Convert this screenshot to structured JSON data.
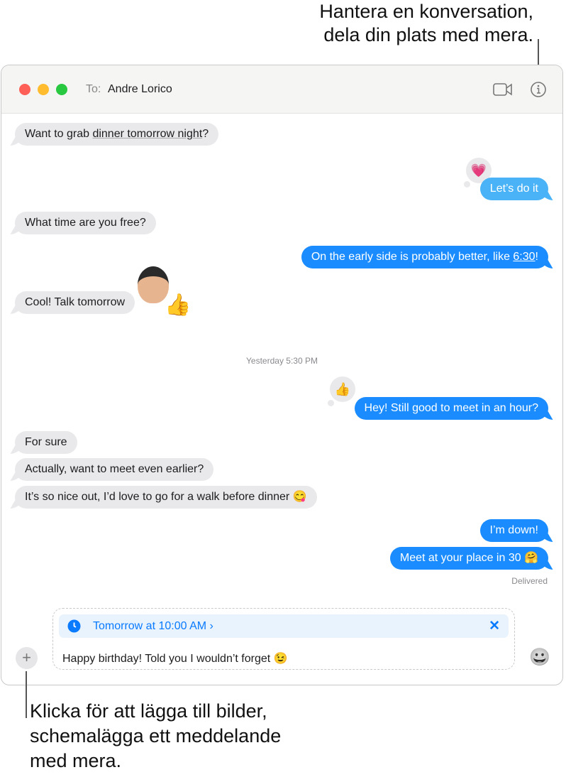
{
  "callouts": {
    "top": [
      "Hantera en konversation,",
      "dela din plats med mera."
    ],
    "bottom": [
      "Klicka för att lägga till bilder,",
      "schemalägga ett meddelande",
      "med mera."
    ]
  },
  "header": {
    "to_label": "To:",
    "recipient": "Andre Lorico",
    "icons": [
      "video-camera-icon",
      "info-icon"
    ]
  },
  "colors": {
    "sent": "#1a8cff",
    "sent_light": "#4ab3f7",
    "received": "#e9e9eb",
    "schedule_bg": "#e8f3fe",
    "link": "#0a7aff"
  },
  "messages": [
    {
      "dir": "in",
      "pre": "Want to grab ",
      "link": "dinner tomorrow night",
      "post": "?"
    },
    {
      "dir": "out",
      "text": "Let’s do it",
      "reaction": "💗"
    },
    {
      "dir": "in",
      "text": "What time are you free?"
    },
    {
      "dir": "out",
      "pre": "On the early side is probably better, like ",
      "link": "6:30",
      "post": "!"
    },
    {
      "dir": "in",
      "text": "Cool! Talk tomorrow",
      "sticker": "👍"
    },
    {
      "dir": "out",
      "text": "Hey! Still good to meet in an hour?",
      "reaction": "👍"
    },
    {
      "dir": "in",
      "text": "For sure"
    },
    {
      "dir": "in",
      "text": "Actually, want to meet even earlier?"
    },
    {
      "dir": "in",
      "text": "It’s so nice out, I’d love to go for a walk before dinner 😋"
    },
    {
      "dir": "out",
      "text": "I’m down!"
    },
    {
      "dir": "out",
      "text": "Meet at your place in 30 🤗"
    }
  ],
  "timestamp": "Yesterday 5:30 PM",
  "status": "Delivered",
  "compose": {
    "schedule": "Tomorrow at 10:00 AM ›",
    "text": "Happy birthday! Told you I wouldn’t forget 😉",
    "emoji_icon": "😀"
  }
}
